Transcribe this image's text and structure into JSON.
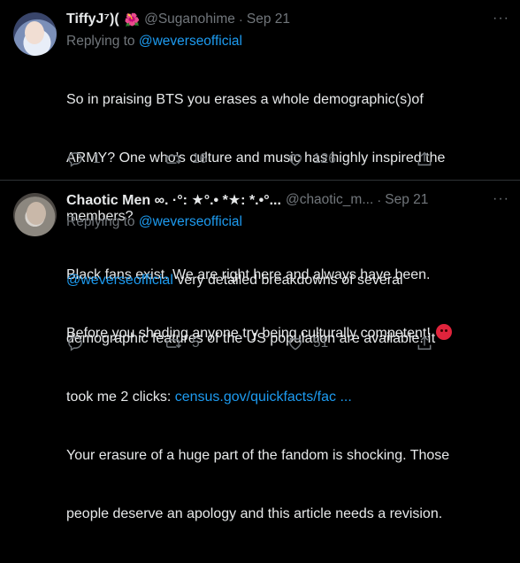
{
  "tweets": [
    {
      "name": "TiffyJ⁷)(",
      "name_emoji": "🌺",
      "handle": "@Suganohime",
      "separator": "·",
      "time": "Sep 21",
      "more": "···",
      "replying_to_label": "Replying to",
      "replying_to_handle": "@weverseofficial",
      "text_lines": [
        "So in praising BTS you erases a whole demographic(s)of",
        "ARMY? One who’s culture and music has highly inspired the",
        "members?",
        "Black fans exist. We are right here and always have been.",
        "Before you shading anyone try being culturally competent!"
      ],
      "reply_count": "1",
      "retweet_count": "16",
      "like_count": "126",
      "share_count": ""
    },
    {
      "name": "Chaotic Men ∞. ·°: ★°.• *★: *.•°...",
      "handle": "@chaotic_m...",
      "separator": "·",
      "time": "Sep 21",
      "more": "···",
      "replying_to_label": "Replying to",
      "replying_to_handle": "@weverseofficial",
      "text_mention": "@weverseofficial",
      "text_line1_rest": " very detailed breakdowns of several",
      "text_line2": "demographic features of the US population are available. It",
      "text_line3_prefix": "took me 2 clicks: ",
      "text_link": "census.gov/quickfacts/fac",
      "text_link_ellipsis": "...",
      "text_line4": "Your erasure of a huge part of the fandom is shocking. Those",
      "text_line5": "people deserve an apology and this article needs a revision.",
      "reply_count": "",
      "retweet_count": "5",
      "like_count": "51",
      "share_count": ""
    }
  ],
  "icons": {
    "reply": "reply-icon",
    "retweet": "retweet-icon",
    "like": "heart-icon",
    "share": "share-icon"
  },
  "colors": {
    "background": "#000000",
    "text": "#e7e9ea",
    "muted": "#71767b",
    "link": "#1d9bf0",
    "divider": "#2f3336"
  }
}
